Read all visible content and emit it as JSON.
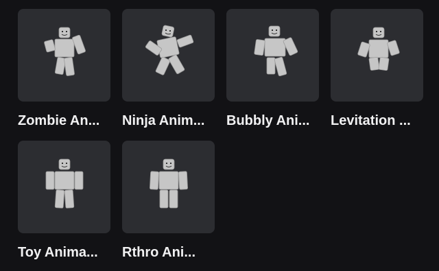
{
  "items": [
    {
      "title": "Zombie An...",
      "pose": "zombie",
      "icon": "avatar-figure-icon"
    },
    {
      "title": "Ninja Anim...",
      "pose": "ninja",
      "icon": "avatar-figure-icon"
    },
    {
      "title": "Bubbly Ani...",
      "pose": "bubbly",
      "icon": "avatar-figure-icon"
    },
    {
      "title": "Levitation ...",
      "pose": "levitation",
      "icon": "avatar-figure-icon"
    },
    {
      "title": "Toy Anima...",
      "pose": "toy",
      "icon": "avatar-figure-icon"
    },
    {
      "title": "Rthro Ani...",
      "pose": "rthro",
      "icon": "avatar-figure-icon"
    }
  ],
  "colors": {
    "background": "#121215",
    "card": "#2c2d31",
    "text": "#f1f1f2",
    "figure": "#c9c9c9"
  }
}
